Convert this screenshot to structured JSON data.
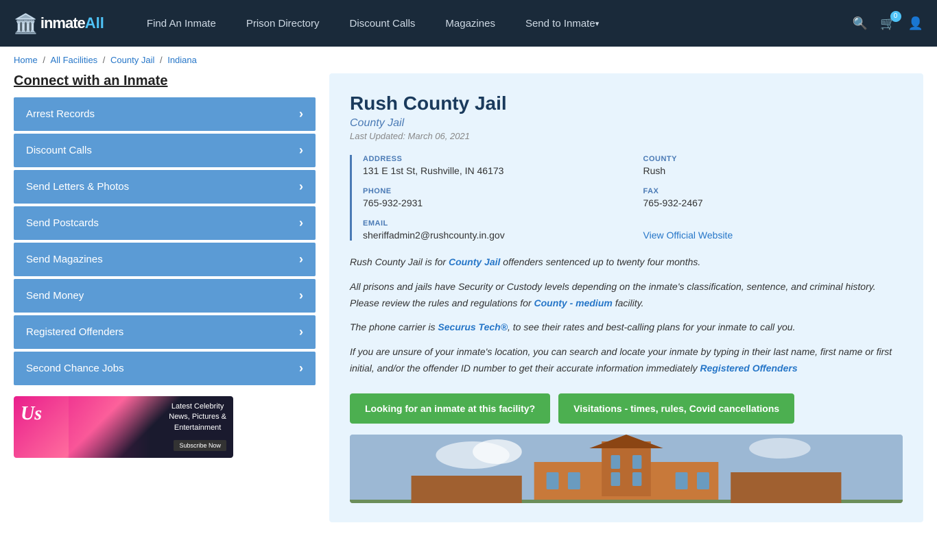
{
  "site": {
    "logo_text": "inmate",
    "logo_all": "All",
    "logo_icon": "🏛️"
  },
  "nav": {
    "links": [
      {
        "label": "Find An Inmate",
        "id": "find-inmate",
        "dropdown": false
      },
      {
        "label": "Prison Directory",
        "id": "prison-directory",
        "dropdown": false
      },
      {
        "label": "Discount Calls",
        "id": "discount-calls",
        "dropdown": false
      },
      {
        "label": "Magazines",
        "id": "magazines",
        "dropdown": false
      },
      {
        "label": "Send to Inmate",
        "id": "send-inmate",
        "dropdown": true
      }
    ],
    "cart_count": "0"
  },
  "breadcrumb": {
    "items": [
      "Home",
      "All Facilities",
      "County Jail",
      "Indiana"
    ],
    "separators": [
      "/",
      "/",
      "/"
    ]
  },
  "sidebar": {
    "title": "Connect with an Inmate",
    "menu_items": [
      {
        "label": "Arrest Records",
        "id": "arrest-records"
      },
      {
        "label": "Discount Calls",
        "id": "discount-calls"
      },
      {
        "label": "Send Letters & Photos",
        "id": "send-letters"
      },
      {
        "label": "Send Postcards",
        "id": "send-postcards"
      },
      {
        "label": "Send Magazines",
        "id": "send-magazines"
      },
      {
        "label": "Send Money",
        "id": "send-money"
      },
      {
        "label": "Registered Offenders",
        "id": "registered-offenders"
      },
      {
        "label": "Second Chance Jobs",
        "id": "second-chance-jobs"
      }
    ],
    "ad": {
      "logo": "Us",
      "text": "Latest Celebrity\nNews, Pictures &\nEntertainment",
      "cta": "Subscribe Now"
    }
  },
  "facility": {
    "name": "Rush County Jail",
    "type": "County Jail",
    "last_updated": "Last Updated: March 06, 2021",
    "address_label": "ADDRESS",
    "address_value": "131 E 1st St, Rushville, IN 46173",
    "county_label": "COUNTY",
    "county_value": "Rush",
    "phone_label": "PHONE",
    "phone_value": "765-932-2931",
    "fax_label": "FAX",
    "fax_value": "765-932-2467",
    "email_label": "EMAIL",
    "email_value": "sheriffadmin2@rushcounty.in.gov",
    "website_label": "View Official Website",
    "website_url": "#",
    "desc1": "Rush County Jail is for County Jail offenders sentenced up to twenty four months.",
    "desc2": "All prisons and jails have Security or Custody levels depending on the inmate's classification, sentence, and criminal history. Please review the rules and regulations for County - medium facility.",
    "desc3": "The phone carrier is Securus Tech®, to see their rates and best-calling plans for your inmate to call you.",
    "desc4": "If you are unsure of your inmate's location, you can search and locate your inmate by typing in their last name, first name or first initial, and/or the offender ID number to get their accurate information immediately Registered Offenders",
    "btn1": "Looking for an inmate at this facility?",
    "btn2": "Visitations - times, rules, Covid cancellations"
  }
}
